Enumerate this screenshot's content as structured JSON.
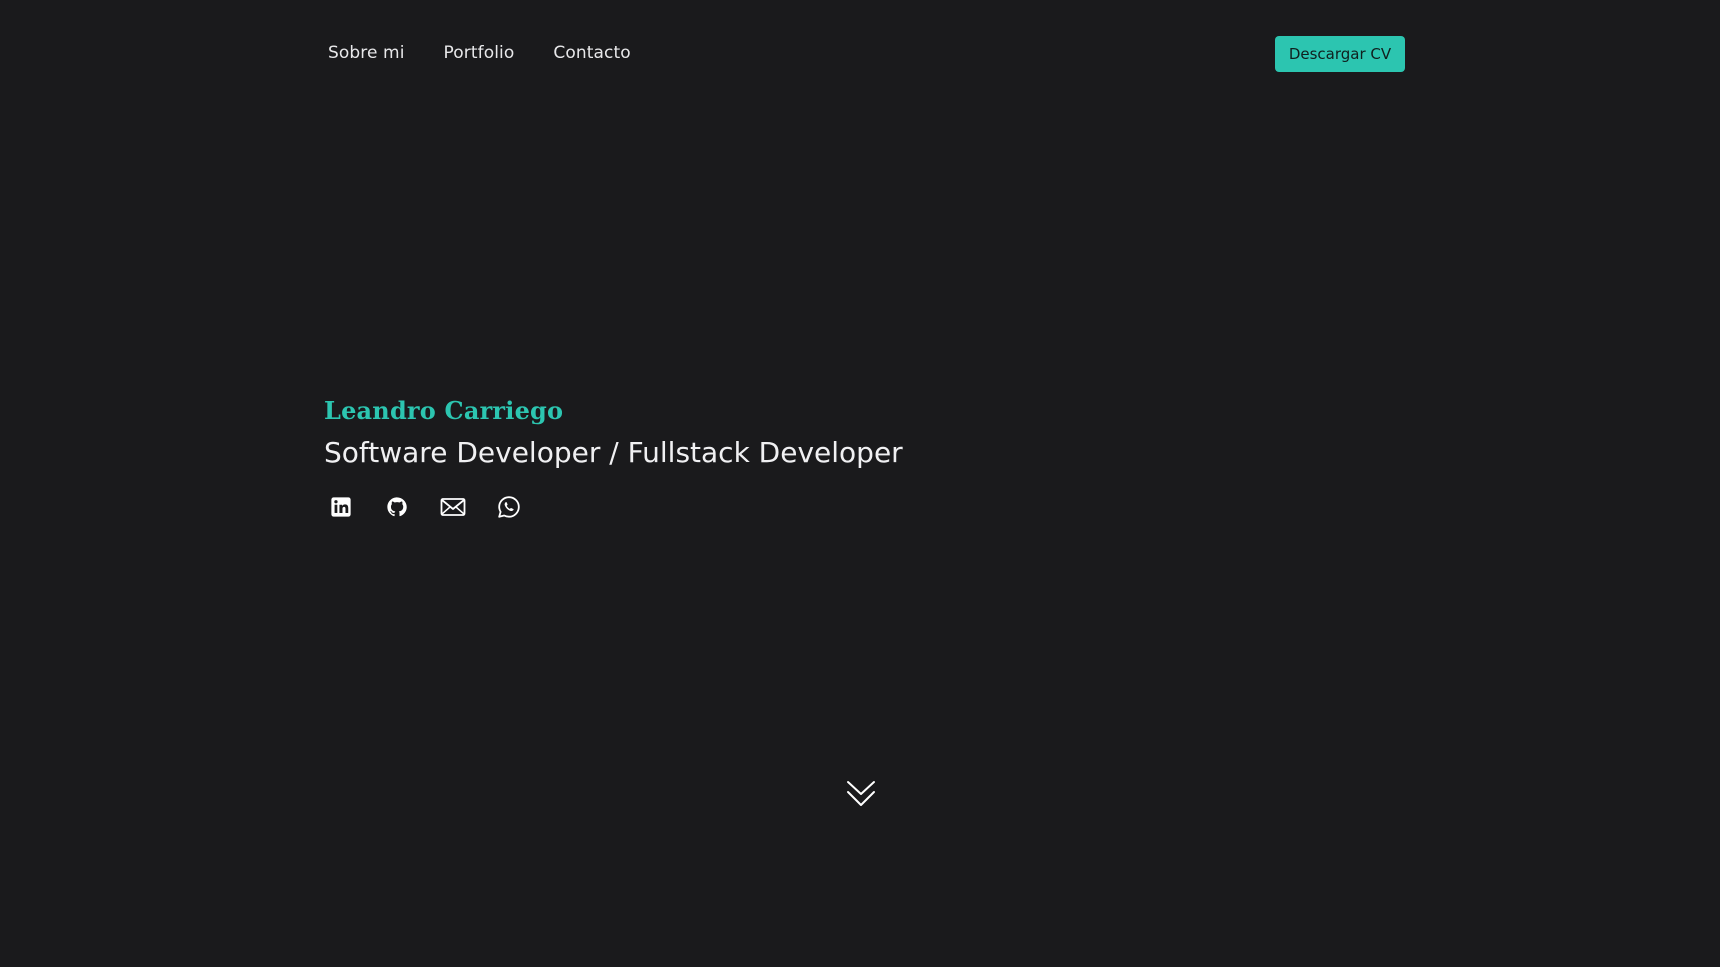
{
  "nav": {
    "links": [
      {
        "label": "Sobre mi"
      },
      {
        "label": "Portfolio"
      },
      {
        "label": "Contacto"
      }
    ],
    "cv_button_label": "Descargar CV"
  },
  "hero": {
    "name": "Leandro Carriego",
    "role": "Software Developer / Fullstack Developer"
  },
  "socials": [
    {
      "icon": "linkedin-icon"
    },
    {
      "icon": "github-icon"
    },
    {
      "icon": "mail-icon"
    },
    {
      "icon": "whatsapp-icon"
    }
  ],
  "scroll_icon": "double-chevron-down-icon",
  "colors": {
    "background": "#1a1a1c",
    "accent": "#2cc5b0",
    "text": "#e8e8ea"
  }
}
